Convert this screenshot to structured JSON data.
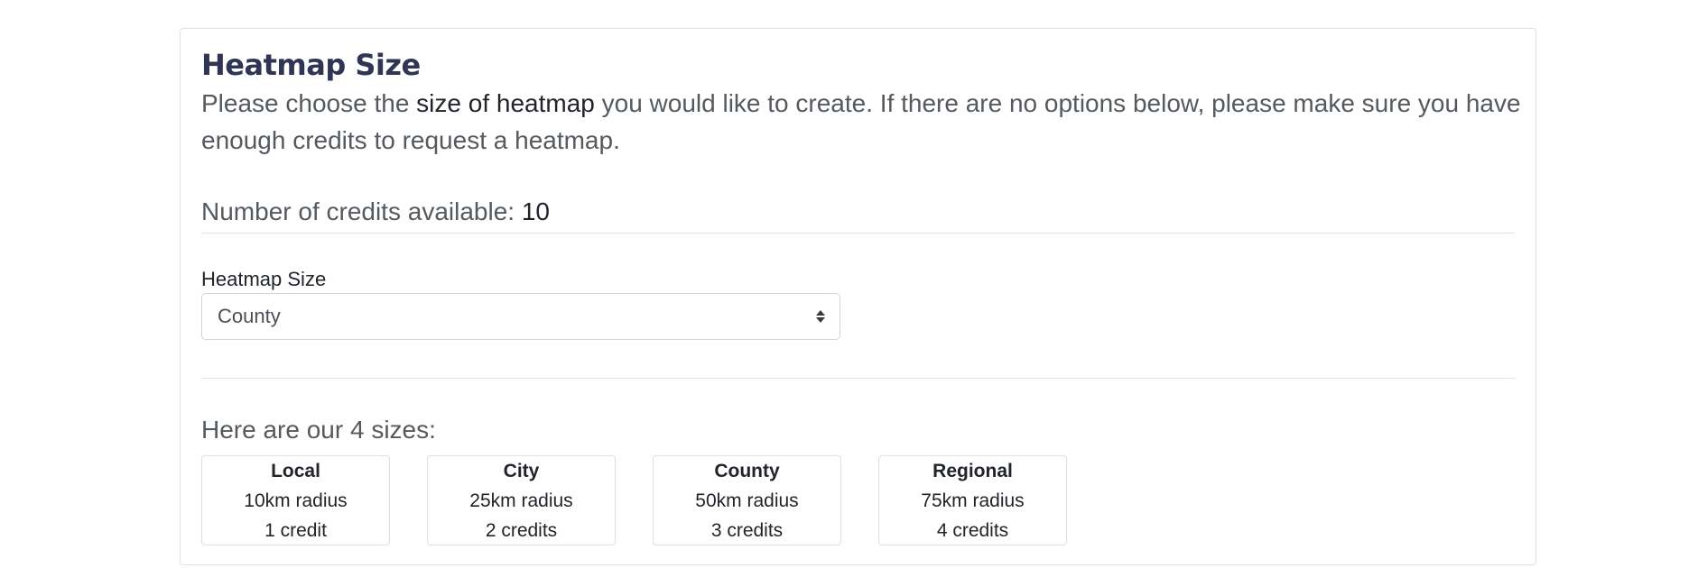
{
  "heading": "Heatmap Size",
  "intro": {
    "before": "Please choose the ",
    "emphasis": "size of heatmap",
    "after": " you would like to create. If there are no options below, please make sure you have enough credits to request a heatmap."
  },
  "credits": {
    "label": "Number of credits available: ",
    "value": "10"
  },
  "form": {
    "label": "Heatmap Size",
    "selected": "County"
  },
  "sizes": {
    "heading": "Here are our 4 sizes:",
    "items": [
      {
        "name": "Local",
        "radius": "10km radius",
        "cost": "1 credit"
      },
      {
        "name": "City",
        "radius": "25km radius",
        "cost": "2 credits"
      },
      {
        "name": "County",
        "radius": "50km radius",
        "cost": "3 credits"
      },
      {
        "name": "Regional",
        "radius": "75km radius",
        "cost": "4 credits"
      }
    ]
  },
  "colors": {
    "heading": "#2f3555",
    "muted_text": "#555a5f",
    "border": "#dee2e6"
  }
}
